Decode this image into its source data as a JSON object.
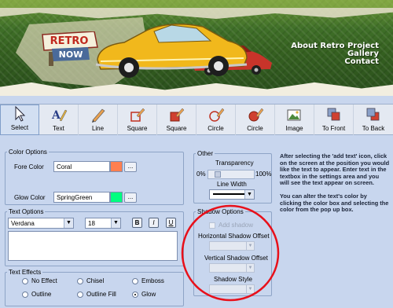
{
  "banner": {
    "logo": "RETRO NOW",
    "nav": [
      "About Retro Project",
      "Gallery",
      "Contact"
    ]
  },
  "toolbar": {
    "tools": [
      {
        "label": "Select",
        "icon": "cursor-arrow-icon",
        "selected": true
      },
      {
        "label": "Text",
        "icon": "text-pen-icon",
        "selected": false
      },
      {
        "label": "Line",
        "icon": "line-pencil-icon",
        "selected": false
      },
      {
        "label": "Square",
        "icon": "square-outline-icon",
        "selected": false
      },
      {
        "label": "Square",
        "icon": "square-filled-icon",
        "selected": false
      },
      {
        "label": "Circle",
        "icon": "circle-outline-icon",
        "selected": false
      },
      {
        "label": "Circle",
        "icon": "circle-filled-icon",
        "selected": false
      },
      {
        "label": "Image",
        "icon": "image-icon",
        "selected": false
      },
      {
        "label": "To Front",
        "icon": "to-front-icon",
        "selected": false
      },
      {
        "label": "To Back",
        "icon": "to-back-icon",
        "selected": false
      }
    ]
  },
  "color_options": {
    "legend": "Color Options",
    "fore_label": "Fore Color",
    "fore_value": "Coral",
    "fore_swatch": "#ff7f50",
    "glow_label": "Glow Color",
    "glow_value": "SpringGreen",
    "glow_swatch": "#00ff7f",
    "picker_button": "..."
  },
  "text_options": {
    "legend": "Text Options",
    "font": "Verdana",
    "size": "18",
    "bold": "B",
    "italic": "I",
    "underline": "U"
  },
  "text_effects": {
    "legend": "Text Effects",
    "options": [
      {
        "label": "No Effect",
        "checked": false
      },
      {
        "label": "Chisel",
        "checked": false
      },
      {
        "label": "Emboss",
        "checked": false
      },
      {
        "label": "Outline",
        "checked": false
      },
      {
        "label": "Outline Fill",
        "checked": false
      },
      {
        "label": "Glow",
        "checked": true
      }
    ]
  },
  "other": {
    "legend": "Other",
    "transparency_label": "Transparency",
    "min_label": "0%",
    "max_label": "100%",
    "transparency_value": 0.15,
    "line_width_label": "Line Width"
  },
  "shadow_options": {
    "legend": "Shadow Options",
    "add_shadow_label": "Add shadow",
    "horizontal_label": "Horizontal Shadow Offset",
    "vertical_label": "Vertical Shadow Offset",
    "style_label": "Shadow Style"
  },
  "help": {
    "paragraph1": "After selecting the 'add text' icon, click on the screen at the position you would like the text to appear. Enter text in the textbox in the settings area and you will see the text appear on screen.",
    "paragraph2": "You can alter the text's color by clicking the color box and selecting the color from the pop up box."
  },
  "colors": {
    "annotation_circle": "#e8101a",
    "panel_bg": "#c8d6ee"
  }
}
